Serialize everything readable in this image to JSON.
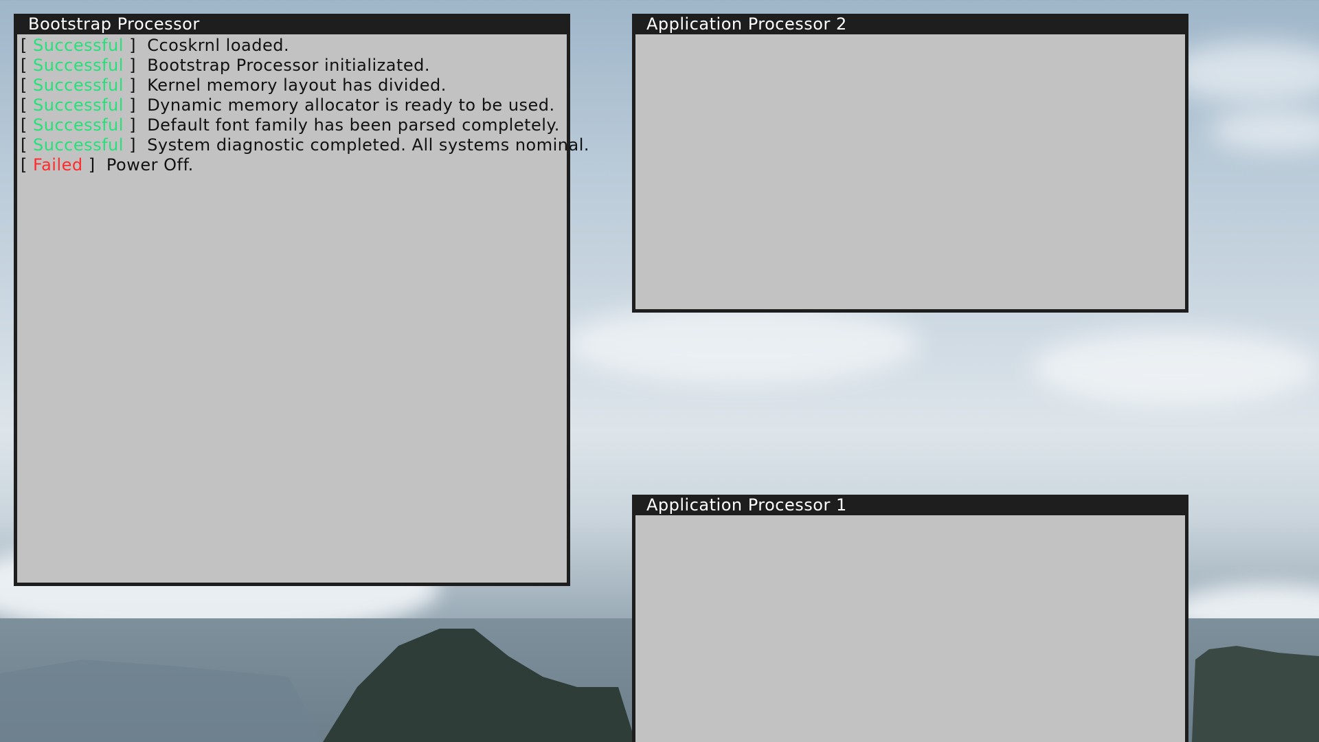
{
  "windows": {
    "bsp": {
      "title": "Bootstrap Processor",
      "lines": [
        {
          "status": "Successful",
          "kind": "ok",
          "message": "Ccoskrnl loaded."
        },
        {
          "status": "Successful",
          "kind": "ok",
          "message": "Bootstrap Processor initializated."
        },
        {
          "status": "Successful",
          "kind": "ok",
          "message": "Kernel memory layout has divided."
        },
        {
          "status": "Successful",
          "kind": "ok",
          "message": "Dynamic memory allocator is ready to be used."
        },
        {
          "status": "Successful",
          "kind": "ok",
          "message": "Default font family has been parsed completely."
        },
        {
          "status": "Successful",
          "kind": "ok",
          "message": "System diagnostic completed. All systems nominal."
        },
        {
          "status": "Failed",
          "kind": "fail",
          "message": "Power Off."
        }
      ]
    },
    "ap2": {
      "title": "Application Processor 2"
    },
    "ap1": {
      "title": "Application Processor 1"
    }
  },
  "colors": {
    "status_ok": "#27e07a",
    "status_fail": "#ff2b2b",
    "window_body": "#c2c2c2",
    "titlebar": "#1e1e1e"
  },
  "labels": {
    "open_bracket": "[ ",
    "close_bracket": " ]  "
  }
}
